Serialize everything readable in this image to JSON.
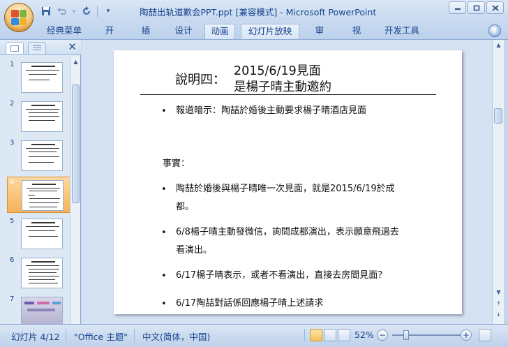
{
  "window": {
    "title": "陶喆出轨道歉会PPT.ppt [兼容模式] - Microsoft PowerPoint",
    "controls": [
      "minimize-icon",
      "restore-icon",
      "close-icon"
    ]
  },
  "qat": {
    "icons": [
      "save-icon",
      "undo-icon",
      "redo-icon",
      "customize-icon"
    ]
  },
  "ribbon": {
    "tabs": [
      "经典菜单",
      "开始",
      "插入",
      "设计",
      "动画",
      "幻灯片放映",
      "审阅",
      "视图",
      "开发工具"
    ]
  },
  "slides_panel": {
    "numbers": [
      "1",
      "2",
      "3",
      "4",
      "5",
      "6",
      "7"
    ],
    "selected": "4"
  },
  "slide": {
    "label": "說明四：",
    "title_line1": "2015/6/19見面",
    "title_line2": "是楊子晴主動邀約",
    "bullet_char": "•",
    "bullet1": "報道暗示：陶喆於婚後主動要求楊子晴酒店見面",
    "facts_heading": "事實：",
    "fact1_line1": "陶喆於婚後與楊子晴唯一次見面，就是2015/6/19於成",
    "fact1_line2": "都。",
    "fact2_line1": "6/8楊子晴主動發微信，詢問成都演出，表示願意飛過去",
    "fact2_line2": "看演出。",
    "fact3": "6/17楊子晴表示，或者不看演出，直接去房間見面？",
    "fact4": "6/17陶喆對話係回應楊子晴上述請求"
  },
  "statusbar": {
    "slide_info": "幻灯片 4/12",
    "theme": "\"Office 主题\"",
    "language": "中文(简体，中国)",
    "zoom": "52%",
    "zoom_minus": "−",
    "zoom_plus": "+"
  },
  "colors": {
    "ribbon_bg": "#c5d6ec",
    "text_blue": "#15428b",
    "selected_thumb": "#f6b25a"
  }
}
